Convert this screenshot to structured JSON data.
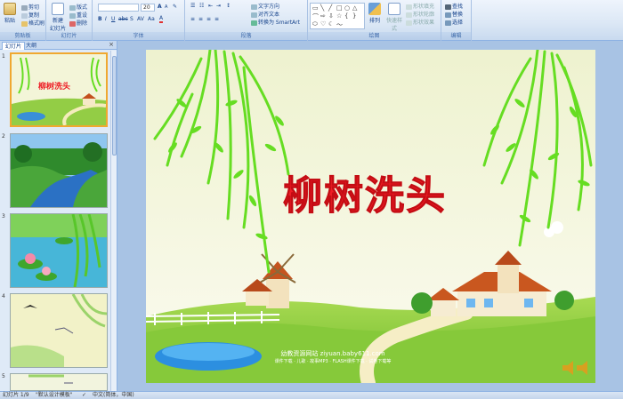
{
  "ribbon": {
    "clipboard": {
      "title": "剪贴板",
      "paste": "粘贴",
      "cut": "剪切",
      "copy": "复制",
      "format_painter": "格式刷"
    },
    "slides": {
      "title": "幻灯片",
      "new_slide": "新建",
      "new_slide2": "幻灯片",
      "layout": "版式",
      "reset": "重设",
      "delete": "删除"
    },
    "font": {
      "title": "字体",
      "size": "20"
    },
    "paragraph": {
      "title": "段落",
      "text_direction": "文字方向",
      "align_text": "对齐文本",
      "smartart": "转换为 SmartArt"
    },
    "drawing": {
      "title": "绘图",
      "arrange": "排列",
      "quick_styles": "快速样式",
      "shape_fill": "形状填充",
      "shape_outline": "形状轮廓",
      "shape_effects": "形状效果"
    },
    "editing": {
      "title": "编辑",
      "find": "查找",
      "replace": "替换",
      "select": "选择"
    }
  },
  "left_panel": {
    "tab_slides": "幻灯片",
    "tab_outline": "大纲",
    "close": "×",
    "thumbnails": [
      {
        "num": "1",
        "title": "柳树洗头"
      },
      {
        "num": "2",
        "title": ""
      },
      {
        "num": "3",
        "title": ""
      },
      {
        "num": "4",
        "title": ""
      },
      {
        "num": "5",
        "title": ""
      }
    ]
  },
  "slide": {
    "title": "柳树洗头",
    "footer_site": "幼教资源网站  ziyuan.baby611.com",
    "footer_sub": "课件下载 · 儿歌 · 故事MP3 · FLASH课件下载 · 试卷下载等"
  },
  "status_bar": {
    "slide_count": "幻灯片 1/9",
    "theme": "\"默认设计模板\"",
    "language": "中文(简体，中国)"
  },
  "colors": {
    "title_red": "#ee1c24",
    "leaf_green": "#66dd22",
    "sky": "#f4f6dc",
    "grass": "#8ccc3a",
    "ribbon_text": "#15428b"
  }
}
